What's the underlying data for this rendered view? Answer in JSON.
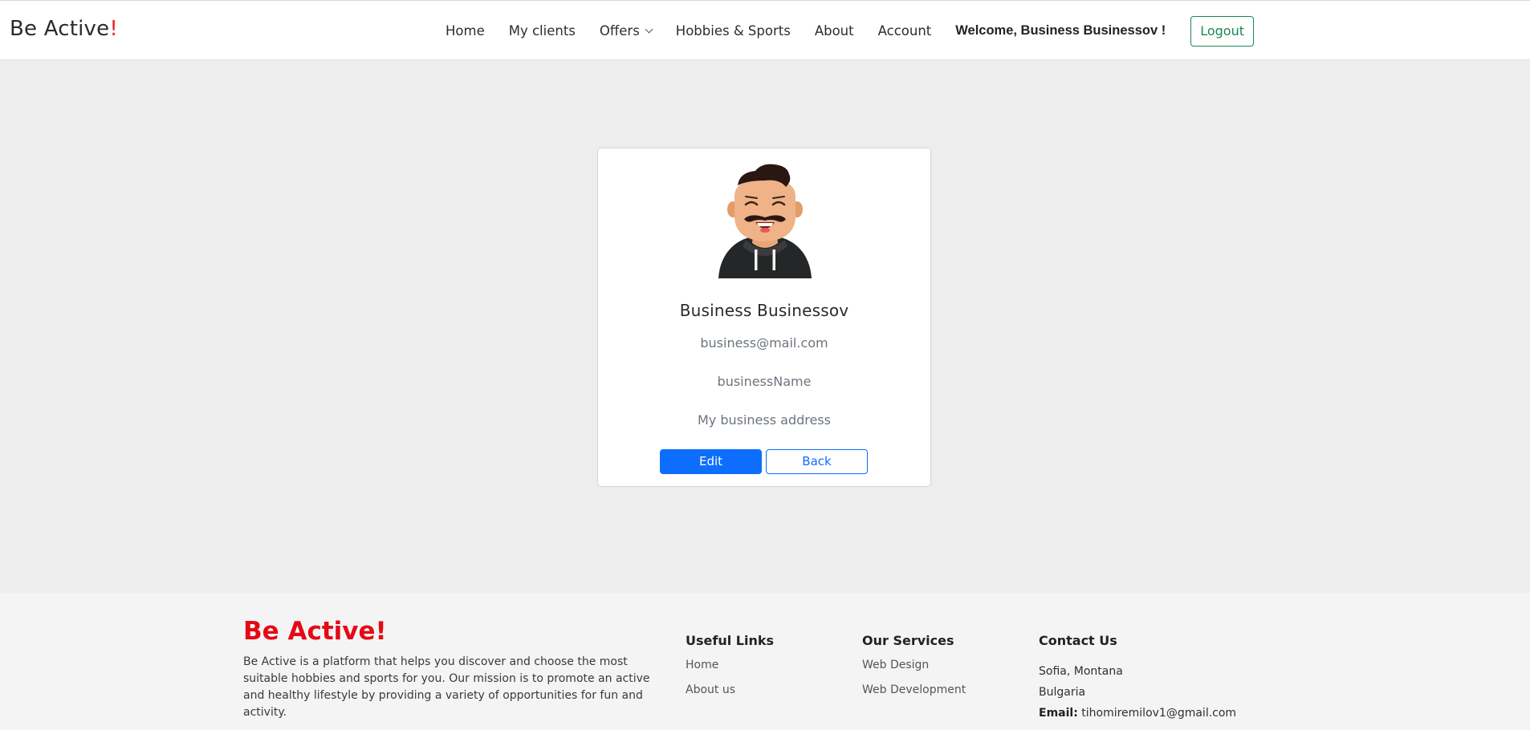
{
  "header": {
    "logo_text": "Be Active",
    "logo_accent": "!",
    "nav": {
      "home": "Home",
      "my_clients": "My clients",
      "offers": "Offers",
      "hobbies": "Hobbies & Sports",
      "about": "About",
      "account": "Account"
    },
    "welcome": "Welcome, Business Businessov !",
    "logout": "Logout"
  },
  "profile": {
    "name": "Business Businessov",
    "email": "business@mail.com",
    "business_name": "businessName",
    "address": "My business address",
    "edit_label": "Edit",
    "back_label": "Back"
  },
  "footer": {
    "brand": "Be Active!",
    "description": "Be Active is a platform that helps you discover and choose the most suitable hobbies and sports for you. Our mission is to promote an active and healthy lifestyle by providing a variety of opportunities for fun and activity.",
    "useful_links": {
      "title": "Useful Links",
      "items": [
        "Home",
        "About us"
      ]
    },
    "services": {
      "title": "Our Services",
      "items": [
        "Web Design",
        "Web Development"
      ]
    },
    "contact": {
      "title": "Contact Us",
      "city": "Sofia, Montana",
      "country": "Bulgaria",
      "email_label": "Email:",
      "email": "tihomiremilov1@gmail.com"
    }
  },
  "colors": {
    "accent_red": "#e50914",
    "primary_blue": "#0d6efd",
    "success_green": "#198754",
    "page_bg": "#ededed"
  },
  "icons": {
    "avatar": "man-with-mustache-avatar",
    "offers_dropdown": "chevron-down-icon"
  }
}
